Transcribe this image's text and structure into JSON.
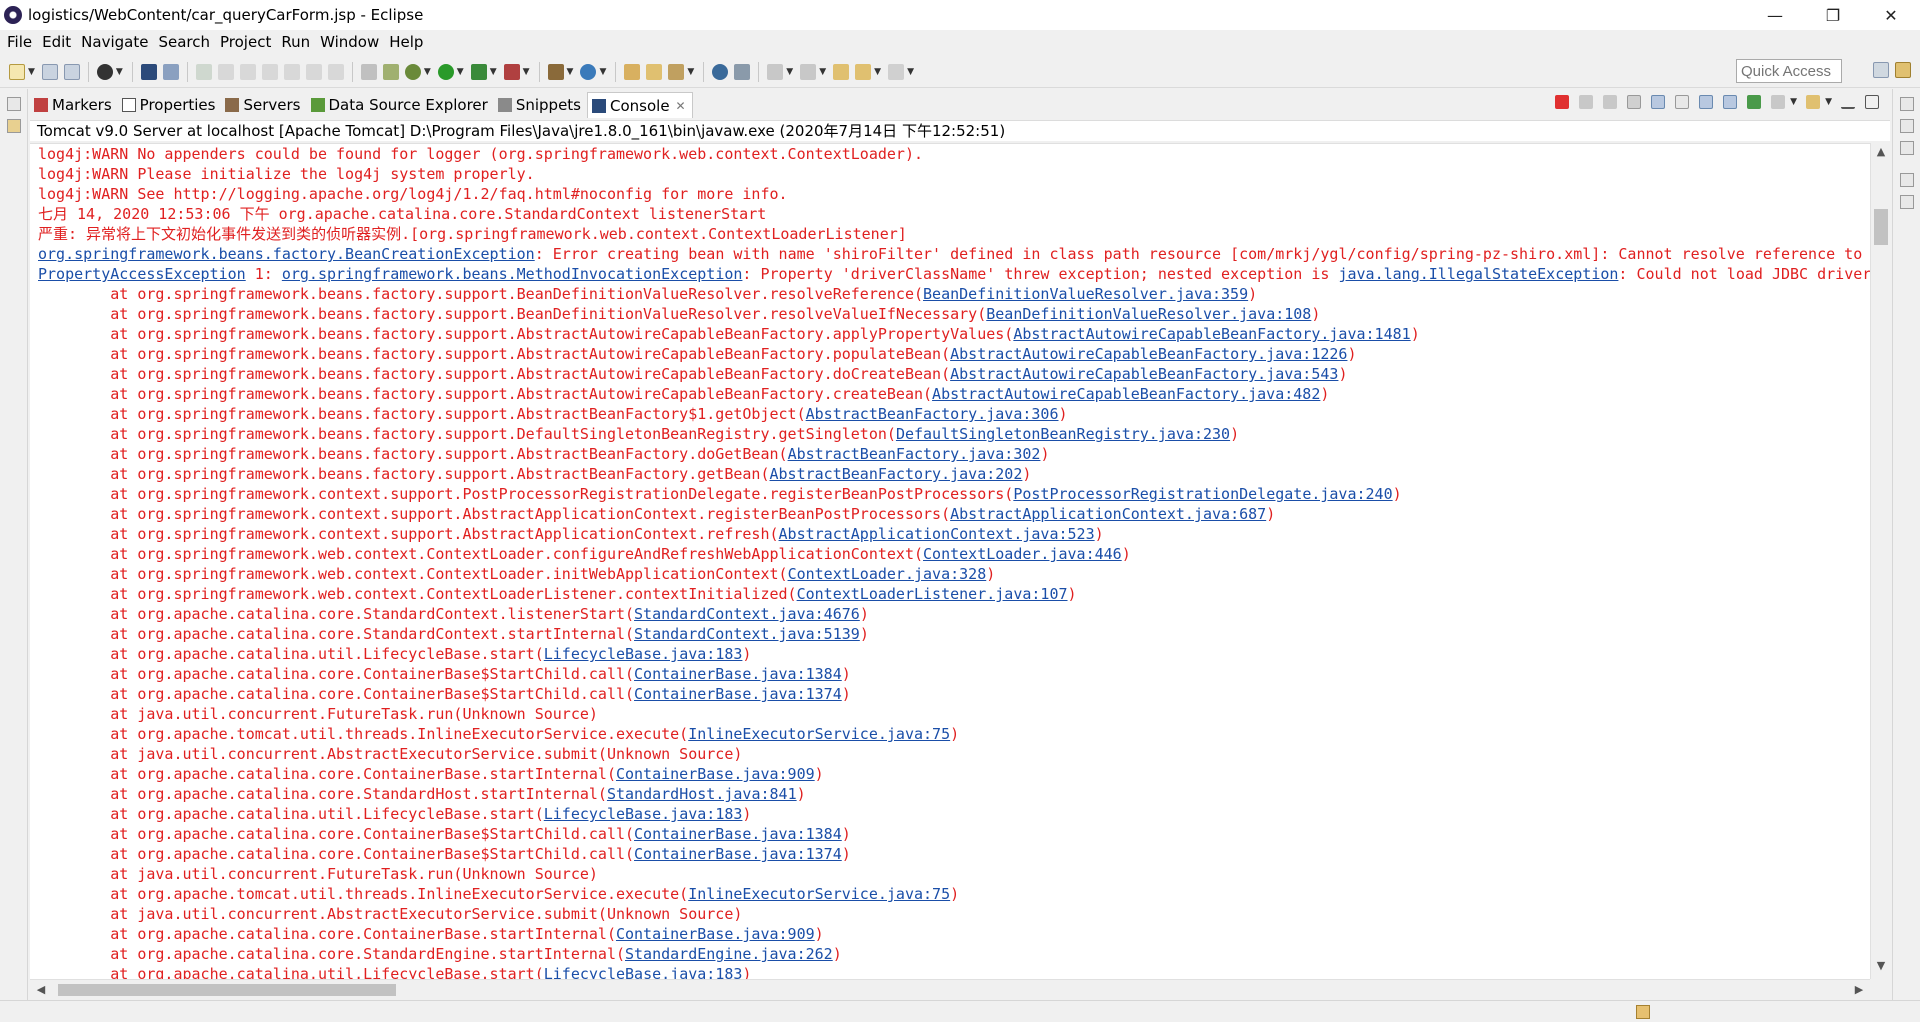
{
  "window": {
    "title": "logistics/WebContent/car_queryCarForm.jsp - Eclipse",
    "minimize": "—",
    "restore": "❐",
    "close": "✕"
  },
  "menu": [
    "File",
    "Edit",
    "Navigate",
    "Search",
    "Project",
    "Run",
    "Window",
    "Help"
  ],
  "toolbar": {
    "quick_access_placeholder": "Quick Access"
  },
  "tabs": [
    {
      "label": "Markers",
      "icon": "markers-icon"
    },
    {
      "label": "Properties",
      "icon": "properties-icon"
    },
    {
      "label": "Servers",
      "icon": "servers-icon"
    },
    {
      "label": "Data Source Explorer",
      "icon": "data-source-icon"
    },
    {
      "label": "Snippets",
      "icon": "snippets-icon"
    },
    {
      "label": "Console",
      "icon": "console-icon",
      "active": true
    }
  ],
  "console": {
    "description": "Tomcat v9.0 Server at localhost [Apache Tomcat] D:\\Program Files\\Java\\jre1.8.0_161\\bin\\javaw.exe (2020年7月14日 下午12:52:51)",
    "lines": [
      [
        {
          "t": "log4j:WARN No appenders could be found for logger (org.springframework.web.context.ContextLoader)."
        }
      ],
      [
        {
          "t": "log4j:WARN Please initialize the log4j system properly."
        }
      ],
      [
        {
          "t": "log4j:WARN See http://logging.apache.org/log4j/1.2/faq.html#noconfig for more info."
        }
      ],
      [
        {
          "t": "七月 14, 2020 12:53:06 下午 org.apache.catalina.core.StandardContext listenerStart"
        }
      ],
      [
        {
          "t": "严重: 异常将上下文初始化事件发送到类的侦听器实例.[org.springframework.web.context.ContextLoaderListener]"
        }
      ],
      [
        {
          "t": "org.springframework.beans.factory.BeanCreationException",
          "link": true
        },
        {
          "t": ": Error creating bean with name 'shiroFilter' defined in class path resource [com/mrkj/ygl/config/spring-pz-shiro.xml]: Cannot resolve reference to"
        }
      ],
      [
        {
          "t": "PropertyAccessException",
          "link": true
        },
        {
          "t": " 1: "
        },
        {
          "t": "org.springframework.beans.MethodInvocationException",
          "link": true
        },
        {
          "t": ": Property 'driverClassName' threw exception; nested exception is "
        },
        {
          "t": "java.lang.IllegalStateException",
          "link": true
        },
        {
          "t": ": Could not load JDBC driver"
        }
      ],
      [
        {
          "t": "\tat org.springframework.beans.factory.support.BeanDefinitionValueResolver.resolveReference("
        },
        {
          "t": "BeanDefinitionValueResolver.java:359",
          "link": true
        },
        {
          "t": ")"
        }
      ],
      [
        {
          "t": "\tat org.springframework.beans.factory.support.BeanDefinitionValueResolver.resolveValueIfNecessary("
        },
        {
          "t": "BeanDefinitionValueResolver.java:108",
          "link": true
        },
        {
          "t": ")"
        }
      ],
      [
        {
          "t": "\tat org.springframework.beans.factory.support.AbstractAutowireCapableBeanFactory.applyPropertyValues("
        },
        {
          "t": "AbstractAutowireCapableBeanFactory.java:1481",
          "link": true
        },
        {
          "t": ")"
        }
      ],
      [
        {
          "t": "\tat org.springframework.beans.factory.support.AbstractAutowireCapableBeanFactory.populateBean("
        },
        {
          "t": "AbstractAutowireCapableBeanFactory.java:1226",
          "link": true
        },
        {
          "t": ")"
        }
      ],
      [
        {
          "t": "\tat org.springframework.beans.factory.support.AbstractAutowireCapableBeanFactory.doCreateBean("
        },
        {
          "t": "AbstractAutowireCapableBeanFactory.java:543",
          "link": true
        },
        {
          "t": ")"
        }
      ],
      [
        {
          "t": "\tat org.springframework.beans.factory.support.AbstractAutowireCapableBeanFactory.createBean("
        },
        {
          "t": "AbstractAutowireCapableBeanFactory.java:482",
          "link": true
        },
        {
          "t": ")"
        }
      ],
      [
        {
          "t": "\tat org.springframework.beans.factory.support.AbstractBeanFactory$1.getObject("
        },
        {
          "t": "AbstractBeanFactory.java:306",
          "link": true
        },
        {
          "t": ")"
        }
      ],
      [
        {
          "t": "\tat org.springframework.beans.factory.support.DefaultSingletonBeanRegistry.getSingleton("
        },
        {
          "t": "DefaultSingletonBeanRegistry.java:230",
          "link": true
        },
        {
          "t": ")"
        }
      ],
      [
        {
          "t": "\tat org.springframework.beans.factory.support.AbstractBeanFactory.doGetBean("
        },
        {
          "t": "AbstractBeanFactory.java:302",
          "link": true
        },
        {
          "t": ")"
        }
      ],
      [
        {
          "t": "\tat org.springframework.beans.factory.support.AbstractBeanFactory.getBean("
        },
        {
          "t": "AbstractBeanFactory.java:202",
          "link": true
        },
        {
          "t": ")"
        }
      ],
      [
        {
          "t": "\tat org.springframework.context.support.PostProcessorRegistrationDelegate.registerBeanPostProcessors("
        },
        {
          "t": "PostProcessorRegistrationDelegate.java:240",
          "link": true
        },
        {
          "t": ")"
        }
      ],
      [
        {
          "t": "\tat org.springframework.context.support.AbstractApplicationContext.registerBeanPostProcessors("
        },
        {
          "t": "AbstractApplicationContext.java:687",
          "link": true
        },
        {
          "t": ")"
        }
      ],
      [
        {
          "t": "\tat org.springframework.context.support.AbstractApplicationContext.refresh("
        },
        {
          "t": "AbstractApplicationContext.java:523",
          "link": true
        },
        {
          "t": ")"
        }
      ],
      [
        {
          "t": "\tat org.springframework.web.context.ContextLoader.configureAndRefreshWebApplicationContext("
        },
        {
          "t": "ContextLoader.java:446",
          "link": true
        },
        {
          "t": ")"
        }
      ],
      [
        {
          "t": "\tat org.springframework.web.context.ContextLoader.initWebApplicationContext("
        },
        {
          "t": "ContextLoader.java:328",
          "link": true
        },
        {
          "t": ")"
        }
      ],
      [
        {
          "t": "\tat org.springframework.web.context.ContextLoaderListener.contextInitialized("
        },
        {
          "t": "ContextLoaderListener.java:107",
          "link": true
        },
        {
          "t": ")"
        }
      ],
      [
        {
          "t": "\tat org.apache.catalina.core.StandardContext.listenerStart("
        },
        {
          "t": "StandardContext.java:4676",
          "link": true
        },
        {
          "t": ")"
        }
      ],
      [
        {
          "t": "\tat org.apache.catalina.core.StandardContext.startInternal("
        },
        {
          "t": "StandardContext.java:5139",
          "link": true
        },
        {
          "t": ")"
        }
      ],
      [
        {
          "t": "\tat org.apache.catalina.util.LifecycleBase.start("
        },
        {
          "t": "LifecycleBase.java:183",
          "link": true
        },
        {
          "t": ")"
        }
      ],
      [
        {
          "t": "\tat org.apache.catalina.core.ContainerBase$StartChild.call("
        },
        {
          "t": "ContainerBase.java:1384",
          "link": true
        },
        {
          "t": ")"
        }
      ],
      [
        {
          "t": "\tat org.apache.catalina.core.ContainerBase$StartChild.call("
        },
        {
          "t": "ContainerBase.java:1374",
          "link": true
        },
        {
          "t": ")"
        }
      ],
      [
        {
          "t": "\tat java.util.concurrent.FutureTask.run(Unknown Source)"
        }
      ],
      [
        {
          "t": "\tat org.apache.tomcat.util.threads.InlineExecutorService.execute("
        },
        {
          "t": "InlineExecutorService.java:75",
          "link": true
        },
        {
          "t": ")"
        }
      ],
      [
        {
          "t": "\tat java.util.concurrent.AbstractExecutorService.submit(Unknown Source)"
        }
      ],
      [
        {
          "t": "\tat org.apache.catalina.core.ContainerBase.startInternal("
        },
        {
          "t": "ContainerBase.java:909",
          "link": true
        },
        {
          "t": ")"
        }
      ],
      [
        {
          "t": "\tat org.apache.catalina.core.StandardHost.startInternal("
        },
        {
          "t": "StandardHost.java:841",
          "link": true
        },
        {
          "t": ")"
        }
      ],
      [
        {
          "t": "\tat org.apache.catalina.util.LifecycleBase.start("
        },
        {
          "t": "LifecycleBase.java:183",
          "link": true
        },
        {
          "t": ")"
        }
      ],
      [
        {
          "t": "\tat org.apache.catalina.core.ContainerBase$StartChild.call("
        },
        {
          "t": "ContainerBase.java:1384",
          "link": true
        },
        {
          "t": ")"
        }
      ],
      [
        {
          "t": "\tat org.apache.catalina.core.ContainerBase$StartChild.call("
        },
        {
          "t": "ContainerBase.java:1374",
          "link": true
        },
        {
          "t": ")"
        }
      ],
      [
        {
          "t": "\tat java.util.concurrent.FutureTask.run(Unknown Source)"
        }
      ],
      [
        {
          "t": "\tat org.apache.tomcat.util.threads.InlineExecutorService.execute("
        },
        {
          "t": "InlineExecutorService.java:75",
          "link": true
        },
        {
          "t": ")"
        }
      ],
      [
        {
          "t": "\tat java.util.concurrent.AbstractExecutorService.submit(Unknown Source)"
        }
      ],
      [
        {
          "t": "\tat org.apache.catalina.core.ContainerBase.startInternal("
        },
        {
          "t": "ContainerBase.java:909",
          "link": true
        },
        {
          "t": ")"
        }
      ],
      [
        {
          "t": "\tat org.apache.catalina.core.StandardEngine.startInternal("
        },
        {
          "t": "StandardEngine.java:262",
          "link": true
        },
        {
          "t": ")"
        }
      ],
      [
        {
          "t": "\tat org.apache.catalina.util.LifecycleBase.start("
        },
        {
          "t": "LifecycleBase.java:183",
          "link": true
        },
        {
          "t": ")"
        }
      ]
    ]
  },
  "colors": {
    "error_text": "#e02020",
    "link_text": "#1a4ea8",
    "terminate_button": "#e03030"
  }
}
